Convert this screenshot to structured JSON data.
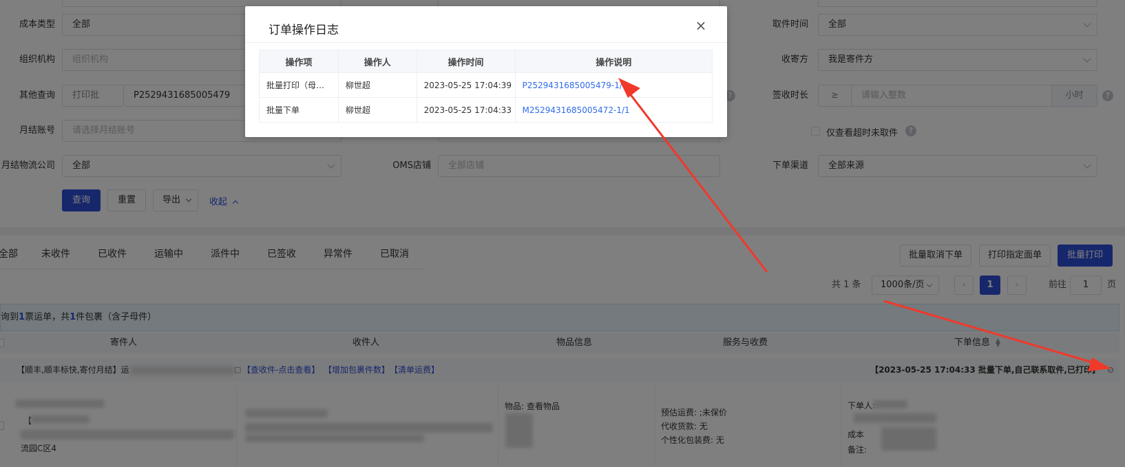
{
  "filters": {
    "cost_type_label": "成本类型",
    "cost_type_value": "全部",
    "org_label": "组织机构",
    "org_placeholder": "组织机构",
    "other_query_label": "其他查询",
    "other_query_type": "打印批",
    "other_query_value": "P2529431685005479",
    "monthly_account_label": "月结账号",
    "monthly_account_placeholder": "请选择月结账号",
    "monthly_logistics_label": "月结物流公司",
    "monthly_logistics_value": "全部",
    "oms_shop_label": "OMS店铺",
    "oms_shop_placeholder": "全部店铺",
    "pickup_time_label": "取件时间",
    "pickup_time_value": "全部",
    "sender_receiver_label": "收寄方",
    "sender_receiver_value": "我是寄件方",
    "sign_duration_label": "签收时长",
    "sign_duration_op": "≥",
    "sign_duration_placeholder": "请输入整数",
    "sign_duration_unit": "小时",
    "overdue_only_label": "仅查看超时未取件",
    "order_channel_label": "下单渠道",
    "order_channel_value": "全部来源"
  },
  "actions": {
    "query": "查询",
    "reset": "重置",
    "export": "导出",
    "collapse": "收起"
  },
  "tabs": [
    "全部",
    "未收件",
    "已收件",
    "运输中",
    "派件中",
    "已签收",
    "异常件",
    "已取消"
  ],
  "toolbar": {
    "batch_cancel": "批量取消下单",
    "print_specified": "打印指定面单",
    "batch_print": "批量打印"
  },
  "pager": {
    "total": "共 1 条",
    "page_size": "1000条/页",
    "current": "1",
    "goto_label": "前往",
    "goto_value": "1",
    "page_unit": "页"
  },
  "info_bar": {
    "pre": "询到",
    "count1": "1",
    "mid": "票运单，共",
    "count2": "1",
    "post": "件包裹（含子母件）"
  },
  "table_headers": [
    "寄件人",
    "收件人",
    "物品信息",
    "服务与收费",
    "下单信息"
  ],
  "order": {
    "tag": "【顺丰,顺丰标快,寄付月结】运",
    "link1": "【查收件-点击查看】",
    "link2": "【增加包裹件数】",
    "link3": "【清单运费】",
    "right_info": "【2023-05-25 17:04:33 批量下单,自己联系取件,已打印】",
    "goods_label": "物品:",
    "goods_link": "查看物品",
    "fee_est": "预估运费: ;未保价",
    "cod": "代收货款: 无",
    "pack_fee": "个性化包装费: 无",
    "sender_prefix": "【",
    "sender_addr": "流园C区4",
    "order_by": "下单人:",
    "cost": "成本",
    "remark": "备注:"
  },
  "dialog": {
    "title": "订单操作日志",
    "headers": [
      "操作项",
      "操作人",
      "操作时间",
      "操作说明"
    ],
    "rows": [
      {
        "item": "批量打印（母…",
        "operator": "柳世超",
        "time": "2023-05-25 17:04:39",
        "desc": "P2529431685005479-1/1"
      },
      {
        "item": "批量下单",
        "operator": "柳世超",
        "time": "2023-05-25 17:04:33",
        "desc": "M2529431685005472-1/1"
      }
    ]
  },
  "colors": {
    "primary": "#2f4fd8",
    "link": "#2f6be8",
    "annotation_arrow": "#f0392b"
  }
}
